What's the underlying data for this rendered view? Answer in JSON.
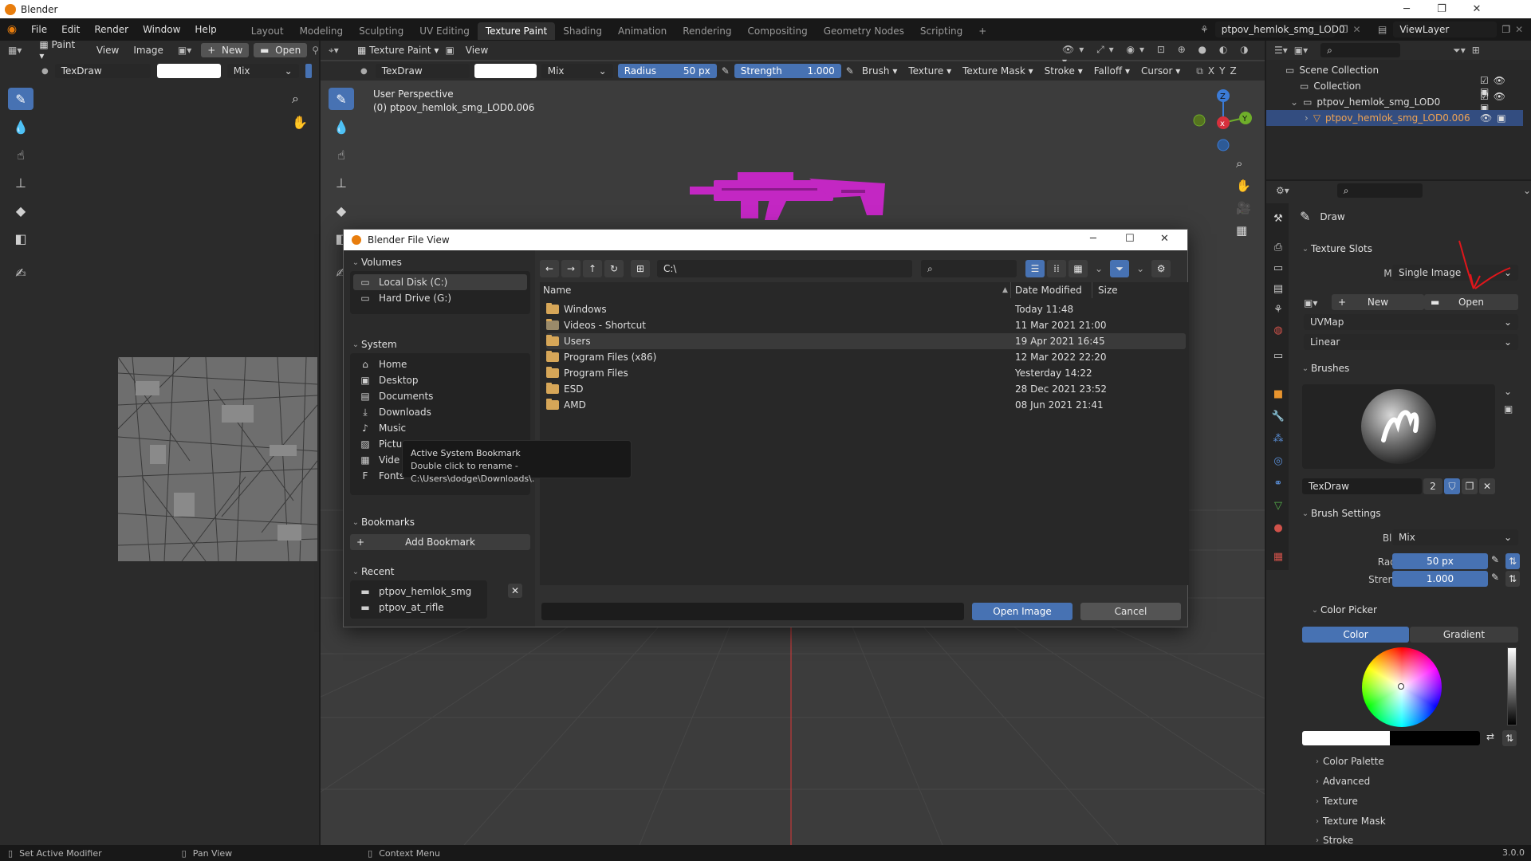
{
  "window": {
    "title": "Blender",
    "version": "3.0.0"
  },
  "menu": [
    "File",
    "Edit",
    "Render",
    "Window",
    "Help"
  ],
  "workspaces": [
    "Layout",
    "Modeling",
    "Sculpting",
    "UV Editing",
    "Texture Paint",
    "Shading",
    "Animation",
    "Rendering",
    "Compositing",
    "Geometry Nodes",
    "Scripting"
  ],
  "active_workspace": "Texture Paint",
  "scene_name": "ptpov_hemlok_smg_LOD0",
  "view_layer": "ViewLayer",
  "image_editor": {
    "mode": "Paint",
    "menus": [
      "View",
      "Image"
    ],
    "new_label": "New",
    "open_label": "Open",
    "brush": "TexDraw",
    "blend": "Mix"
  },
  "viewport": {
    "mode": "Texture Paint",
    "view_label": "View",
    "brush": "TexDraw",
    "blend": "Mix",
    "radius_label": "Radius",
    "radius_value": "50 px",
    "strength_label": "Strength",
    "strength_value": "1.000",
    "header_menus": [
      "Brush",
      "Texture",
      "Texture Mask",
      "Stroke",
      "Falloff",
      "Cursor"
    ],
    "axes": [
      "X",
      "Y",
      "Z"
    ],
    "perspective": "User Perspective",
    "object_info": "(0) ptpov_hemlok_smg_LOD0.006",
    "gizmo_axes": {
      "z": "Z",
      "y": "Y"
    }
  },
  "file_dialog": {
    "title": "Blender File View",
    "path": "C:\\",
    "volumes_label": "Volumes",
    "volumes": [
      "Local Disk (C:)",
      "Hard Drive (G:)"
    ],
    "system_label": "System",
    "system": [
      "Home",
      "Desktop",
      "Documents",
      "Downloads",
      "Music",
      "Pictu",
      "Vide",
      "Fonts"
    ],
    "bookmarks_label": "Bookmarks",
    "add_bookmark": "Add Bookmark",
    "recent_label": "Recent",
    "recent": [
      "ptpov_hemlok_smg",
      "ptpov_at_rifle"
    ],
    "columns": {
      "name": "Name",
      "date": "Date Modified",
      "size": "Size"
    },
    "files": [
      {
        "name": "Windows",
        "date": "Today 11:48"
      },
      {
        "name": "Videos - Shortcut",
        "date": "11 Mar 2021 21:00"
      },
      {
        "name": "Users",
        "date": "19 Apr 2021 16:45"
      },
      {
        "name": "Program Files (x86)",
        "date": "12 Mar 2022 22:20"
      },
      {
        "name": "Program Files",
        "date": "Yesterday 14:22"
      },
      {
        "name": "ESD",
        "date": "28 Dec 2021 23:52"
      },
      {
        "name": "AMD",
        "date": "08 Jun 2021 21:41"
      }
    ],
    "filename_value": "",
    "open_button": "Open Image",
    "cancel_button": "Cancel",
    "tooltip_title": "Active System Bookmark",
    "tooltip_body": "Double click to rename - C:\\Users\\dodge\\Downloads\\."
  },
  "outliner": {
    "scene_collection": "Scene Collection",
    "items": [
      "Collection",
      "ptpov_hemlok_smg_LOD0",
      "ptpov_hemlok_smg_LOD0.006"
    ]
  },
  "properties": {
    "tool_name": "Draw",
    "texture_slots_label": "Texture Slots",
    "mode_label": "Mode",
    "mode_value": "Single Image",
    "new_label": "New",
    "open_label": "Open",
    "uvmap": "UVMap",
    "interpolation": "Linear",
    "brushes_label": "Brushes",
    "brush_name": "TexDraw",
    "brush_users": "2",
    "brush_settings_label": "Brush Settings",
    "blend_label": "Blend",
    "blend_value": "Mix",
    "radius_label": "Radius",
    "radius_value": "50 px",
    "strength_label": "Strength",
    "strength_value": "1.000",
    "color_picker_label": "Color Picker",
    "color_tab": "Color",
    "gradient_tab": "Gradient",
    "collapsed_panels": [
      "Color Palette",
      "Advanced",
      "Texture",
      "Texture Mask",
      "Stroke"
    ]
  },
  "status": {
    "left": "Set Active Modifier",
    "middle": "Pan View",
    "right": "Context Menu"
  },
  "colors": {
    "accent": "#4772b3",
    "gun": "#c327c3",
    "folder": "#d6a658",
    "annotation_arrow": "#e0161b"
  }
}
